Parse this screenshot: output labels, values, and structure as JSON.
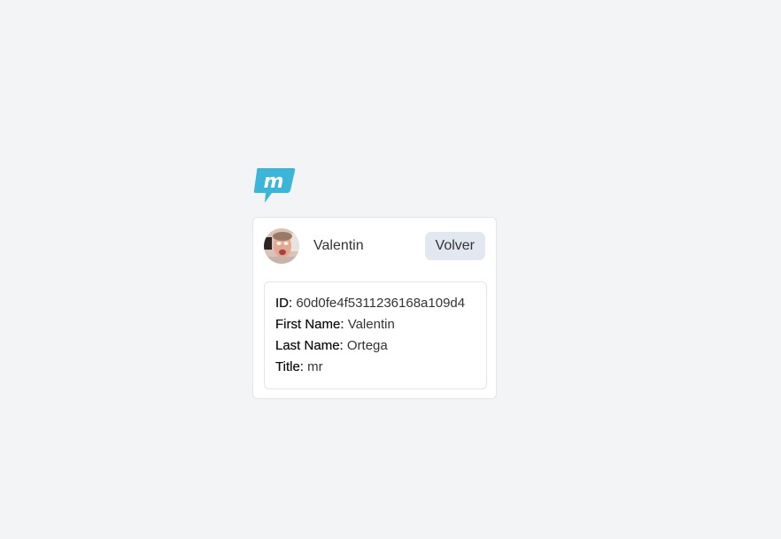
{
  "header": {
    "logo_icon": "m-speech-bubble-icon",
    "logo_color": "#3bb5d8"
  },
  "user": {
    "name": "Valentin",
    "back_label": "Volver",
    "avatar_icon": "user-photo-avatar"
  },
  "details": {
    "id_label": "ID:",
    "id_value": "60d0fe4f5311236168a109d4",
    "first_name_label": "First Name:",
    "first_name_value": "Valentin",
    "last_name_label": "Last Name:",
    "last_name_value": "Ortega",
    "title_label": "Title:",
    "title_value": "mr"
  }
}
